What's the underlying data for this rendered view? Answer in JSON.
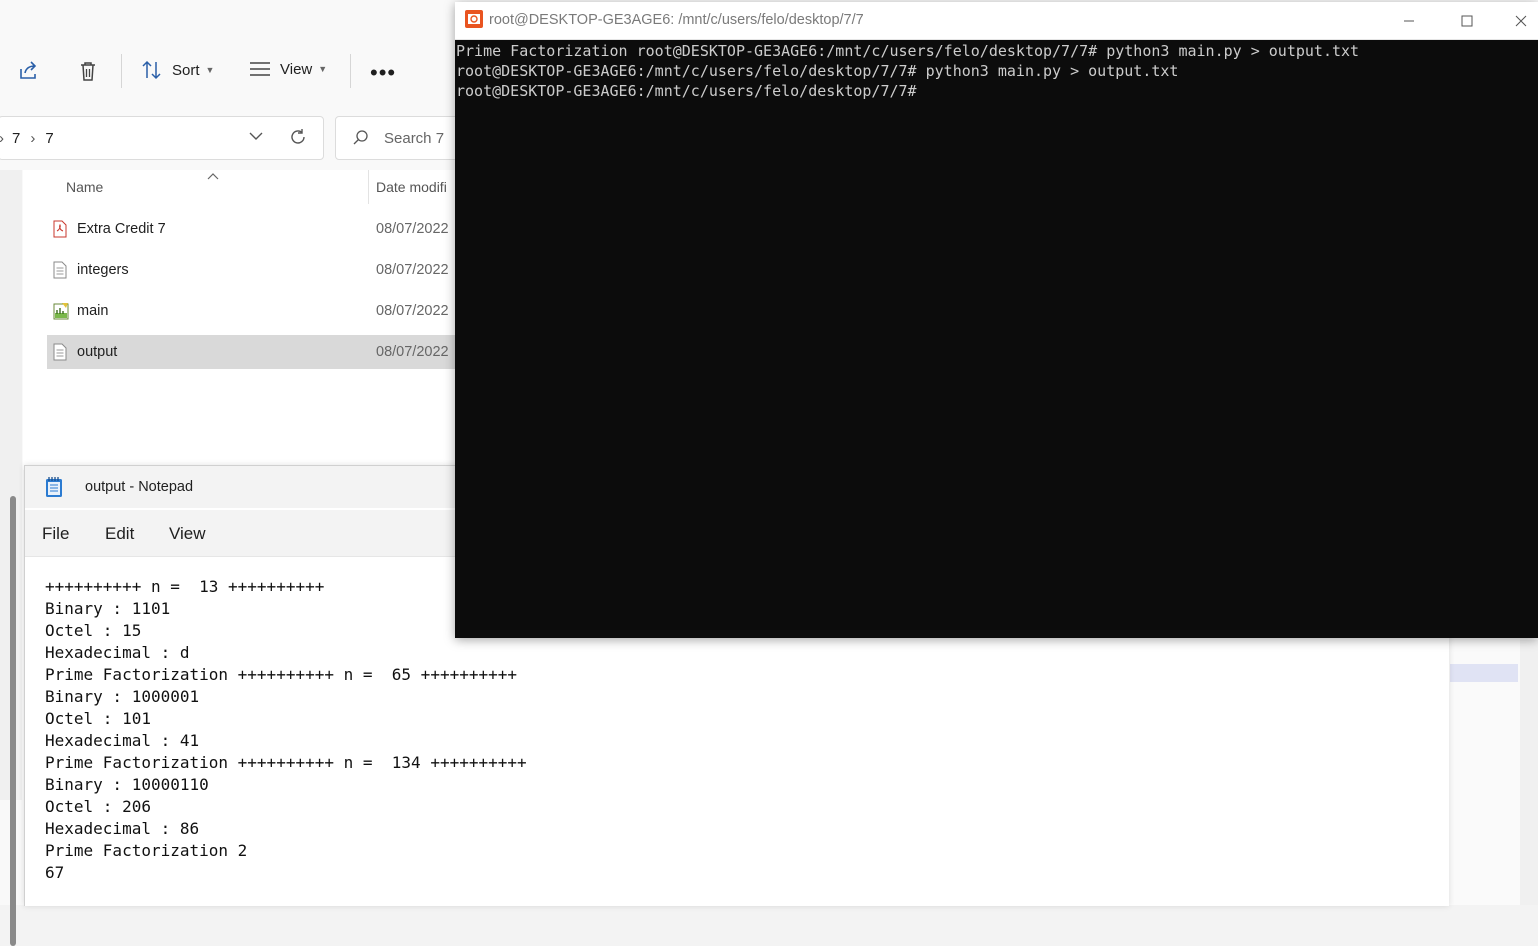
{
  "explorer": {
    "toolbar": {
      "sort_label": "Sort",
      "view_label": "View"
    },
    "address": {
      "crumbs": [
        "7",
        "7"
      ]
    },
    "search": {
      "placeholder": "Search 7"
    },
    "columns": {
      "name": "Name",
      "date": "Date modifi"
    },
    "files": [
      {
        "name": "Extra Credit 7",
        "date": "08/07/2022",
        "icon": "pdf-file-icon"
      },
      {
        "name": "integers",
        "date": "08/07/2022",
        "icon": "text-file-icon"
      },
      {
        "name": "main",
        "date": "08/07/2022",
        "icon": "python-file-icon"
      },
      {
        "name": "output",
        "date": "08/07/2022",
        "icon": "text-file-icon",
        "selected": true
      }
    ]
  },
  "notepad": {
    "title": "output - Notepad",
    "menu": {
      "file": "File",
      "edit": "Edit",
      "view": "View"
    },
    "content": "++++++++++ n =  13 ++++++++++\nBinary : 1101\nOctel : 15\nHexadecimal : d\nPrime Factorization ++++++++++ n =  65 ++++++++++\nBinary : 1000001\nOctel : 101\nHexadecimal : 41\nPrime Factorization ++++++++++ n =  134 ++++++++++\nBinary : 10000110\nOctel : 206\nHexadecimal : 86\nPrime Factorization 2\n67"
  },
  "terminal": {
    "title": "root@DESKTOP-GE3AGE6: /mnt/c/users/felo/desktop/7/7",
    "output": "Prime Factorization root@DESKTOP-GE3AGE6:/mnt/c/users/felo/desktop/7/7# python3 main.py > output.txt\nroot@DESKTOP-GE3AGE6:/mnt/c/users/felo/desktop/7/7# python3 main.py > output.txt\nroot@DESKTOP-GE3AGE6:/mnt/c/users/felo/desktop/7/7#"
  },
  "colors": {
    "terminal_bg": "#0c0c0c",
    "terminal_fg": "#cccccc",
    "selection": "#d9d9d9",
    "ubuntu_orange": "#e95420"
  }
}
